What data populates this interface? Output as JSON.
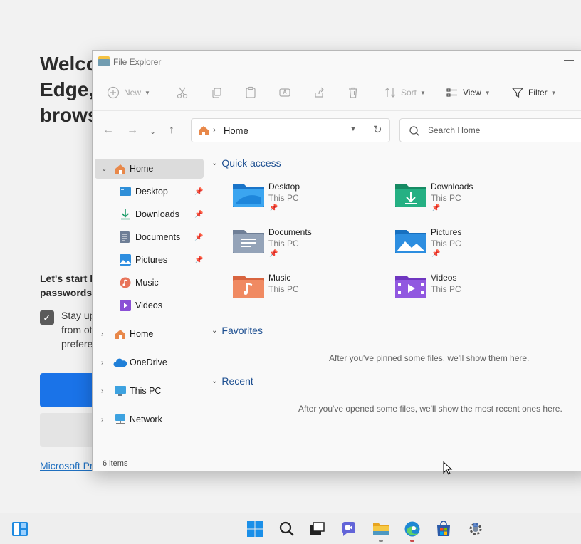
{
  "edge": {
    "title": "Welco\nEdge,\nbrows",
    "text": "Let's start b\npasswords,",
    "check_label": "Stay up\nfrom ot\nprefere",
    "link": "Microsoft Pr"
  },
  "window": {
    "title": "File Explorer",
    "minimize": "—"
  },
  "toolbar": {
    "new": "New",
    "sort": "Sort",
    "view": "View",
    "filter": "Filter"
  },
  "address": {
    "location": "Home",
    "search_placeholder": "Search Home"
  },
  "sidebar": {
    "items": [
      {
        "label": "Home",
        "icon": "home-icon"
      },
      {
        "label": "Desktop",
        "icon": "desktop-icon"
      },
      {
        "label": "Downloads",
        "icon": "download-icon"
      },
      {
        "label": "Documents",
        "icon": "documents-icon"
      },
      {
        "label": "Pictures",
        "icon": "pictures-icon"
      },
      {
        "label": "Music",
        "icon": "music-icon"
      },
      {
        "label": "Videos",
        "icon": "videos-icon"
      },
      {
        "label": "Home",
        "icon": "home-icon"
      },
      {
        "label": "OneDrive",
        "icon": "onedrive-icon"
      },
      {
        "label": "This PC",
        "icon": "this-pc-icon"
      },
      {
        "label": "Network",
        "icon": "network-icon"
      }
    ]
  },
  "content": {
    "quick_access_title": "Quick access",
    "favorites_title": "Favorites",
    "recent_title": "Recent",
    "favorites_empty": "After you've pinned some files, we'll show them here.",
    "recent_empty": "After you've opened some files, we'll show the most recent ones here.",
    "quick_access": [
      {
        "name": "Desktop",
        "location": "This PC",
        "pinned": true
      },
      {
        "name": "Downloads",
        "location": "This PC",
        "pinned": true
      },
      {
        "name": "Documents",
        "location": "This PC",
        "pinned": true
      },
      {
        "name": "Pictures",
        "location": "This PC",
        "pinned": true
      },
      {
        "name": "Music",
        "location": "This PC",
        "pinned": false
      },
      {
        "name": "Videos",
        "location": "This PC",
        "pinned": false
      }
    ]
  },
  "status": {
    "items": "6 items"
  },
  "colors": {
    "accent": "#1d4f91",
    "edge_blue": "#1a73e8",
    "folder_yellow": "#f4c243"
  }
}
